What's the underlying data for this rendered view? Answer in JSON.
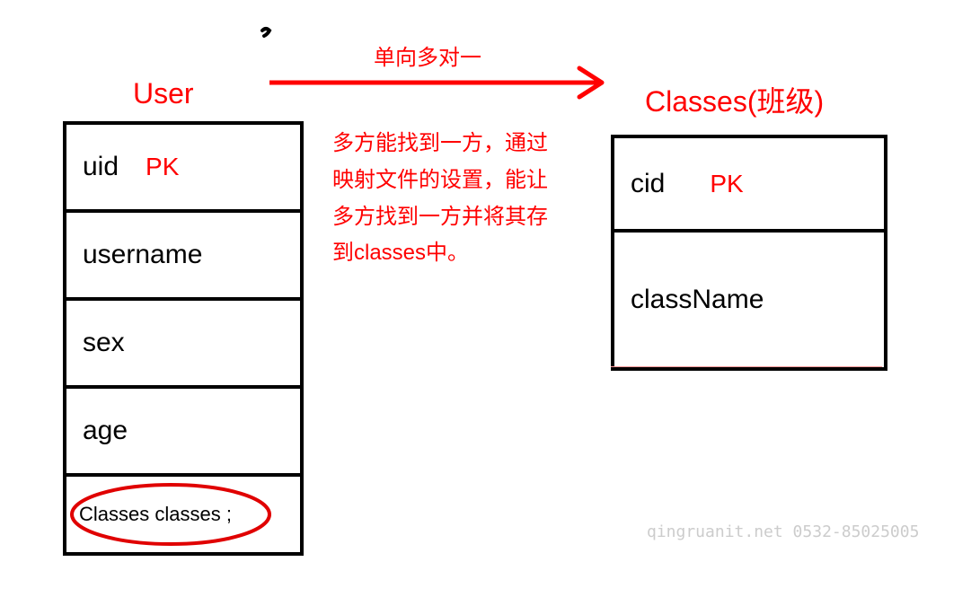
{
  "diagram": {
    "relationship_label": "单向多对一",
    "description": "多方能找到一方，通过映射文件的设置，能让多方找到一方并将其存到classes中。",
    "entities": {
      "user": {
        "title": "User",
        "pk_label": "PK",
        "fields": {
          "f1": "uid",
          "f2": "username",
          "f3": "sex",
          "f4": "age",
          "f5": "Classes classes ;"
        }
      },
      "classes": {
        "title": "Classes(班级)",
        "pk_label": "PK",
        "fields": {
          "f1": "cid",
          "f2": "className"
        }
      }
    }
  },
  "watermark": "qingruanit.net 0532-85025005"
}
